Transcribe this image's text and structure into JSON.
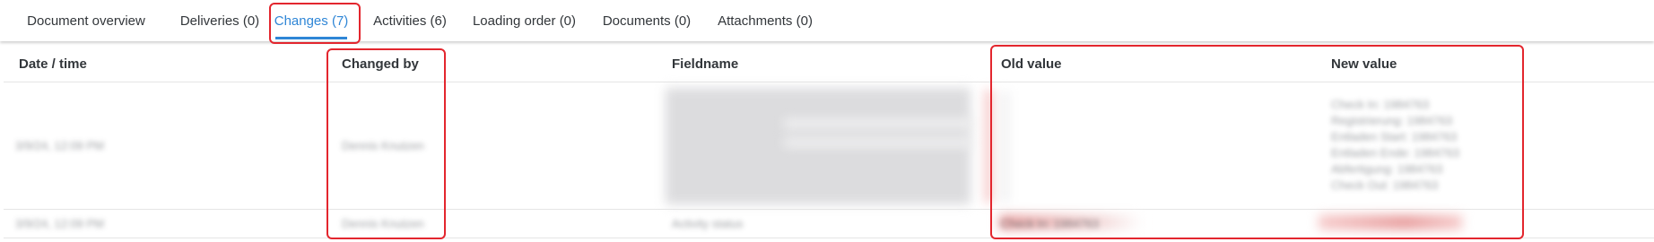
{
  "tabs": [
    {
      "label": "Document overview",
      "active": false
    },
    {
      "label": "Deliveries (0)",
      "active": false
    },
    {
      "label": "Changes (7)",
      "active": true
    },
    {
      "label": "Activities (6)",
      "active": false
    },
    {
      "label": "Loading order (0)",
      "active": false
    },
    {
      "label": "Documents (0)",
      "active": false
    },
    {
      "label": "Attachments (0)",
      "active": false
    }
  ],
  "table": {
    "columns": [
      "Date / time",
      "Changed by",
      "Fieldname",
      "Old value",
      "New value"
    ],
    "rows": [
      {
        "datetime": "3/9/24, 12:09 PM",
        "changed_by": "Dennis Knutzen",
        "fieldname": "",
        "old_value": "",
        "new_value_lines": [
          "Check In: 1984763",
          "Registrierung: 1984763",
          "Entladen Start: 1984763",
          "Entladen Ende: 1984763",
          "Abfertigung: 1984763",
          "Check Out: 1984763"
        ]
      },
      {
        "datetime": "3/9/24, 12:09 PM",
        "changed_by": "Dennis Knutzen",
        "fieldname": "Activity status",
        "old_value": "Check In: 1984763",
        "new_value": "Check Out: 1984763"
      }
    ]
  },
  "colors": {
    "accent": "#2f86d6",
    "annotation": "#e3262e",
    "text": "#32363a",
    "border": "#e5e5e5"
  }
}
